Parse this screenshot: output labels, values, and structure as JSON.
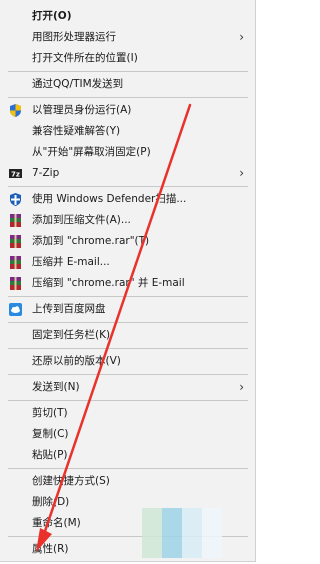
{
  "menu": {
    "items": [
      {
        "label": "打开(O)",
        "bold": true
      },
      {
        "label": "用图形处理器运行",
        "has_submenu": true
      },
      {
        "label": "打开文件所在的位置(I)"
      },
      {
        "label": "通过QQ/TIM发送到"
      },
      {
        "label": "以管理员身份运行(A)",
        "icon": "shield-icon"
      },
      {
        "label": "兼容性疑难解答(Y)"
      },
      {
        "label": "从\"开始\"屏幕取消固定(P)"
      },
      {
        "label": "7-Zip",
        "icon": "7zip-icon",
        "has_submenu": true
      },
      {
        "label": "使用 Windows Defender扫描...",
        "icon": "defender-icon"
      },
      {
        "label": "添加到压缩文件(A)...",
        "icon": "winrar-icon"
      },
      {
        "label": "添加到 \"chrome.rar\"(T)",
        "icon": "winrar-icon"
      },
      {
        "label": "压缩并 E-mail...",
        "icon": "winrar-icon"
      },
      {
        "label": "压缩到 \"chrome.rar\" 并 E-mail",
        "icon": "winrar-icon"
      },
      {
        "label": "上传到百度网盘",
        "icon": "baidu-cloud-icon"
      },
      {
        "label": "固定到任务栏(K)"
      },
      {
        "label": "还原以前的版本(V)"
      },
      {
        "label": "发送到(N)",
        "has_submenu": true
      },
      {
        "label": "剪切(T)"
      },
      {
        "label": "复制(C)"
      },
      {
        "label": "粘贴(P)"
      },
      {
        "label": "创建快捷方式(S)"
      },
      {
        "label": "删除(D)"
      },
      {
        "label": "重命名(M)"
      },
      {
        "label": "属性(R)"
      }
    ],
    "chevron": "›"
  },
  "colors": {
    "menu_bg": "#f2f2f2",
    "separator": "#c8c8c8",
    "annotation_arrow": "#e8322b"
  }
}
